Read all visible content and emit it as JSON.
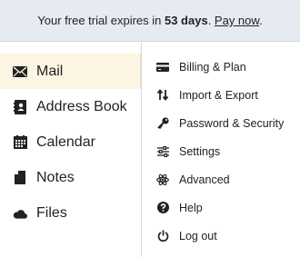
{
  "banner": {
    "prefix": "Your free trial expires in ",
    "days": "53 days",
    "separator": ". ",
    "link": "Pay now",
    "suffix": "."
  },
  "nav": {
    "items": [
      {
        "label": "Mail",
        "icon": "envelope-icon",
        "active": true
      },
      {
        "label": "Address Book",
        "icon": "address-book-icon"
      },
      {
        "label": "Calendar",
        "icon": "calendar-icon"
      },
      {
        "label": "Notes",
        "icon": "note-icon"
      },
      {
        "label": "Files",
        "icon": "cloud-icon"
      }
    ]
  },
  "menu": {
    "items": [
      {
        "label": "Billing & Plan",
        "icon": "credit-card-icon"
      },
      {
        "label": "Import & Export",
        "icon": "import-export-icon"
      },
      {
        "label": "Password & Security",
        "icon": "key-icon"
      },
      {
        "label": "Settings",
        "icon": "sliders-icon"
      },
      {
        "label": "Advanced",
        "icon": "atom-icon"
      },
      {
        "label": "Help",
        "icon": "help-icon"
      },
      {
        "label": "Log out",
        "icon": "power-icon"
      }
    ]
  },
  "colors": {
    "banner_bg": "#e6ebf2",
    "active_bg": "#fcf5e3"
  }
}
